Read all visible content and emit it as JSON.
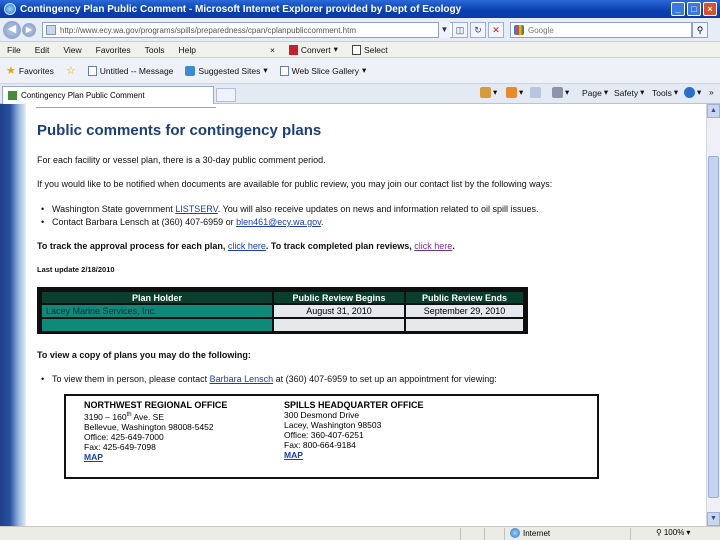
{
  "window": {
    "title": "Contingency Plan Public Comment - Microsoft Internet Explorer provided by Dept of Ecology"
  },
  "address_bar": {
    "url": "http://www.ecy.wa.gov/programs/spills/preparedness/cpan/cplanpubliccomment.htm",
    "search_placeholder": "Google"
  },
  "menu": {
    "items": [
      "File",
      "Edit",
      "View",
      "Favorites",
      "Tools",
      "Help"
    ],
    "convert_label": "Convert",
    "select_label": "Select"
  },
  "favorites_bar": {
    "favorites_label": "Favorites",
    "items": [
      "Untitled -- Message",
      "Suggested Sites",
      "Web Slice Gallery"
    ]
  },
  "tab": {
    "title": "Contingency Plan Public Comment"
  },
  "command_bar": {
    "page_label": "Page",
    "safety_label": "Safety",
    "tools_label": "Tools"
  },
  "page": {
    "heading": "Public comments for contingency plans",
    "intro": "For each facility or vessel plan, there is a 30-day public comment period.",
    "notify": "If you would like to be notified when documents are available for public review, you may join our contact list by the following ways:",
    "bullet1_pre": "Washington State government ",
    "bullet1_link": "LISTSERV",
    "bullet1_post": ". You will also receive updates on news and information related to oil spill issues.",
    "bullet2_pre": "Contact Barbara Lensch at (360) 407-6959 or ",
    "bullet2_link": "blen461@ecy.wa.gov",
    "bullet2_post": ".",
    "track_pre": "To track the approval process for each plan, ",
    "track_link1": "click here",
    "track_mid": ". To track completed plan reviews, ",
    "track_link2": "click here",
    "track_post": ".",
    "last_update": "Last update 2/18/2010",
    "table": {
      "headers": [
        "Plan Holder",
        "Public Review Begins",
        "Public Review Ends"
      ],
      "rows": [
        [
          "Lacey Marine Services, Inc.",
          "August 31, 2010",
          "September 29, 2010"
        ],
        [
          "",
          "",
          ""
        ]
      ]
    },
    "view_heading": "To view a copy of plans you may do the following:",
    "view_bullet_pre": "To view them in person, please contact ",
    "view_bullet_link": "Barbara Lensch",
    "view_bullet_post": " at (360) 407-6959 to set up an appointment for viewing:",
    "offices": [
      {
        "name": "NORTHWEST REGIONAL OFFICE",
        "address1": "3190 – 160",
        "address1_sup": "th",
        "address1_post": " Ave. SE",
        "address2": "Bellevue, Washington 98008-5452",
        "office": "Office: 425-649-7000",
        "fax": "Fax: 425-649-7098",
        "map": "MAP"
      },
      {
        "name": "SPILLS HEADQUARTER OFFICE",
        "address1": "300 Desmond Drive",
        "address2": "Lacey, Washington 98503",
        "office": "Office: 360-407-6251",
        "fax": "Fax: 800-664-9184",
        "map": "MAP"
      }
    ]
  },
  "status_bar": {
    "zone": "Internet",
    "zoom": "100%"
  },
  "colors": {
    "heading": "#1c3f7a",
    "link": "#1a3fb5",
    "table_header": "#0a3f2f",
    "table_teal": "#0e8a7a"
  }
}
